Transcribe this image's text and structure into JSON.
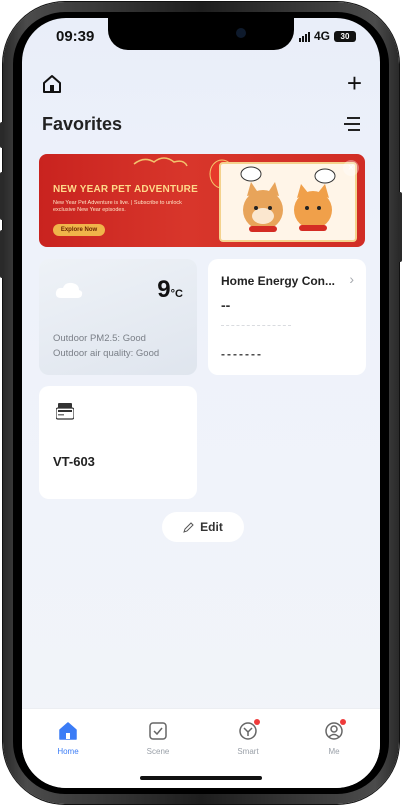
{
  "status_bar": {
    "time": "09:39",
    "network": "4G",
    "battery": "30"
  },
  "header": {
    "title": "Favorites"
  },
  "banner": {
    "title": "NEW YEAR PET ADVENTURE",
    "subtitle": "New Year Pet Adventure is live. | Subscribe to unlock exclusive New Year episodes.",
    "button_label": "Explore Now"
  },
  "weather_card": {
    "temperature": "9",
    "unit": "°C",
    "pm25": "Outdoor PM2.5: Good",
    "air_quality": "Outdoor air quality: Good"
  },
  "energy_card": {
    "title": "Home Energy Con...",
    "value": "--",
    "dashes": "-------"
  },
  "device_card": {
    "name": "VT-603"
  },
  "edit_button": {
    "label": "Edit"
  },
  "bottom_nav": {
    "items": [
      {
        "label": "Home",
        "icon": "home-icon",
        "active": true
      },
      {
        "label": "Scene",
        "icon": "scene-icon",
        "active": false
      },
      {
        "label": "Smart",
        "icon": "smart-icon",
        "active": false
      },
      {
        "label": "Me",
        "icon": "profile-icon",
        "active": false
      }
    ]
  },
  "colors": {
    "accent": "#3b7cf6",
    "banner_red": "#d12d25",
    "badge_red": "#ef3b3b"
  }
}
